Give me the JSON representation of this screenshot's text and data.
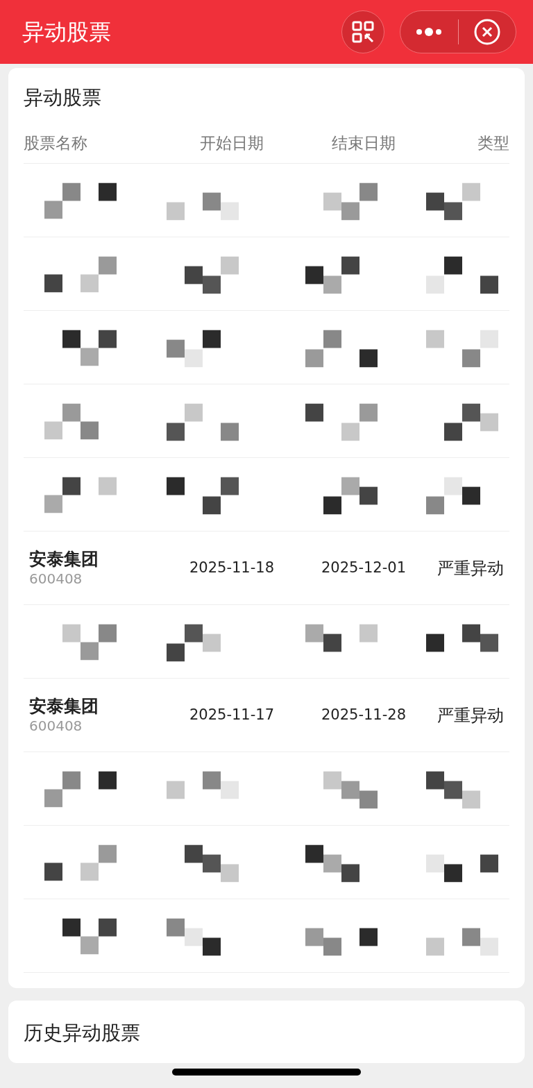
{
  "nav_bar": {
    "title": "异动股票"
  },
  "current_card": {
    "title": "异动股票",
    "columns": [
      "股票名称",
      "开始日期",
      "结束日期",
      "类型"
    ],
    "rows": [
      {
        "kind": "redacted"
      },
      {
        "kind": "redacted"
      },
      {
        "kind": "redacted"
      },
      {
        "kind": "redacted"
      },
      {
        "kind": "redacted"
      },
      {
        "kind": "stock",
        "name": "安泰集团",
        "code": "600408",
        "start": "2025-11-18",
        "end": "2025-12-01",
        "type": "严重异动"
      },
      {
        "kind": "redacted"
      },
      {
        "kind": "stock",
        "name": "安泰集团",
        "code": "600408",
        "start": "2025-11-17",
        "end": "2025-11-28",
        "type": "严重异动"
      },
      {
        "kind": "redacted"
      },
      {
        "kind": "redacted"
      },
      {
        "kind": "redacted"
      }
    ]
  },
  "history_card": {
    "title": "历史异动股票"
  }
}
